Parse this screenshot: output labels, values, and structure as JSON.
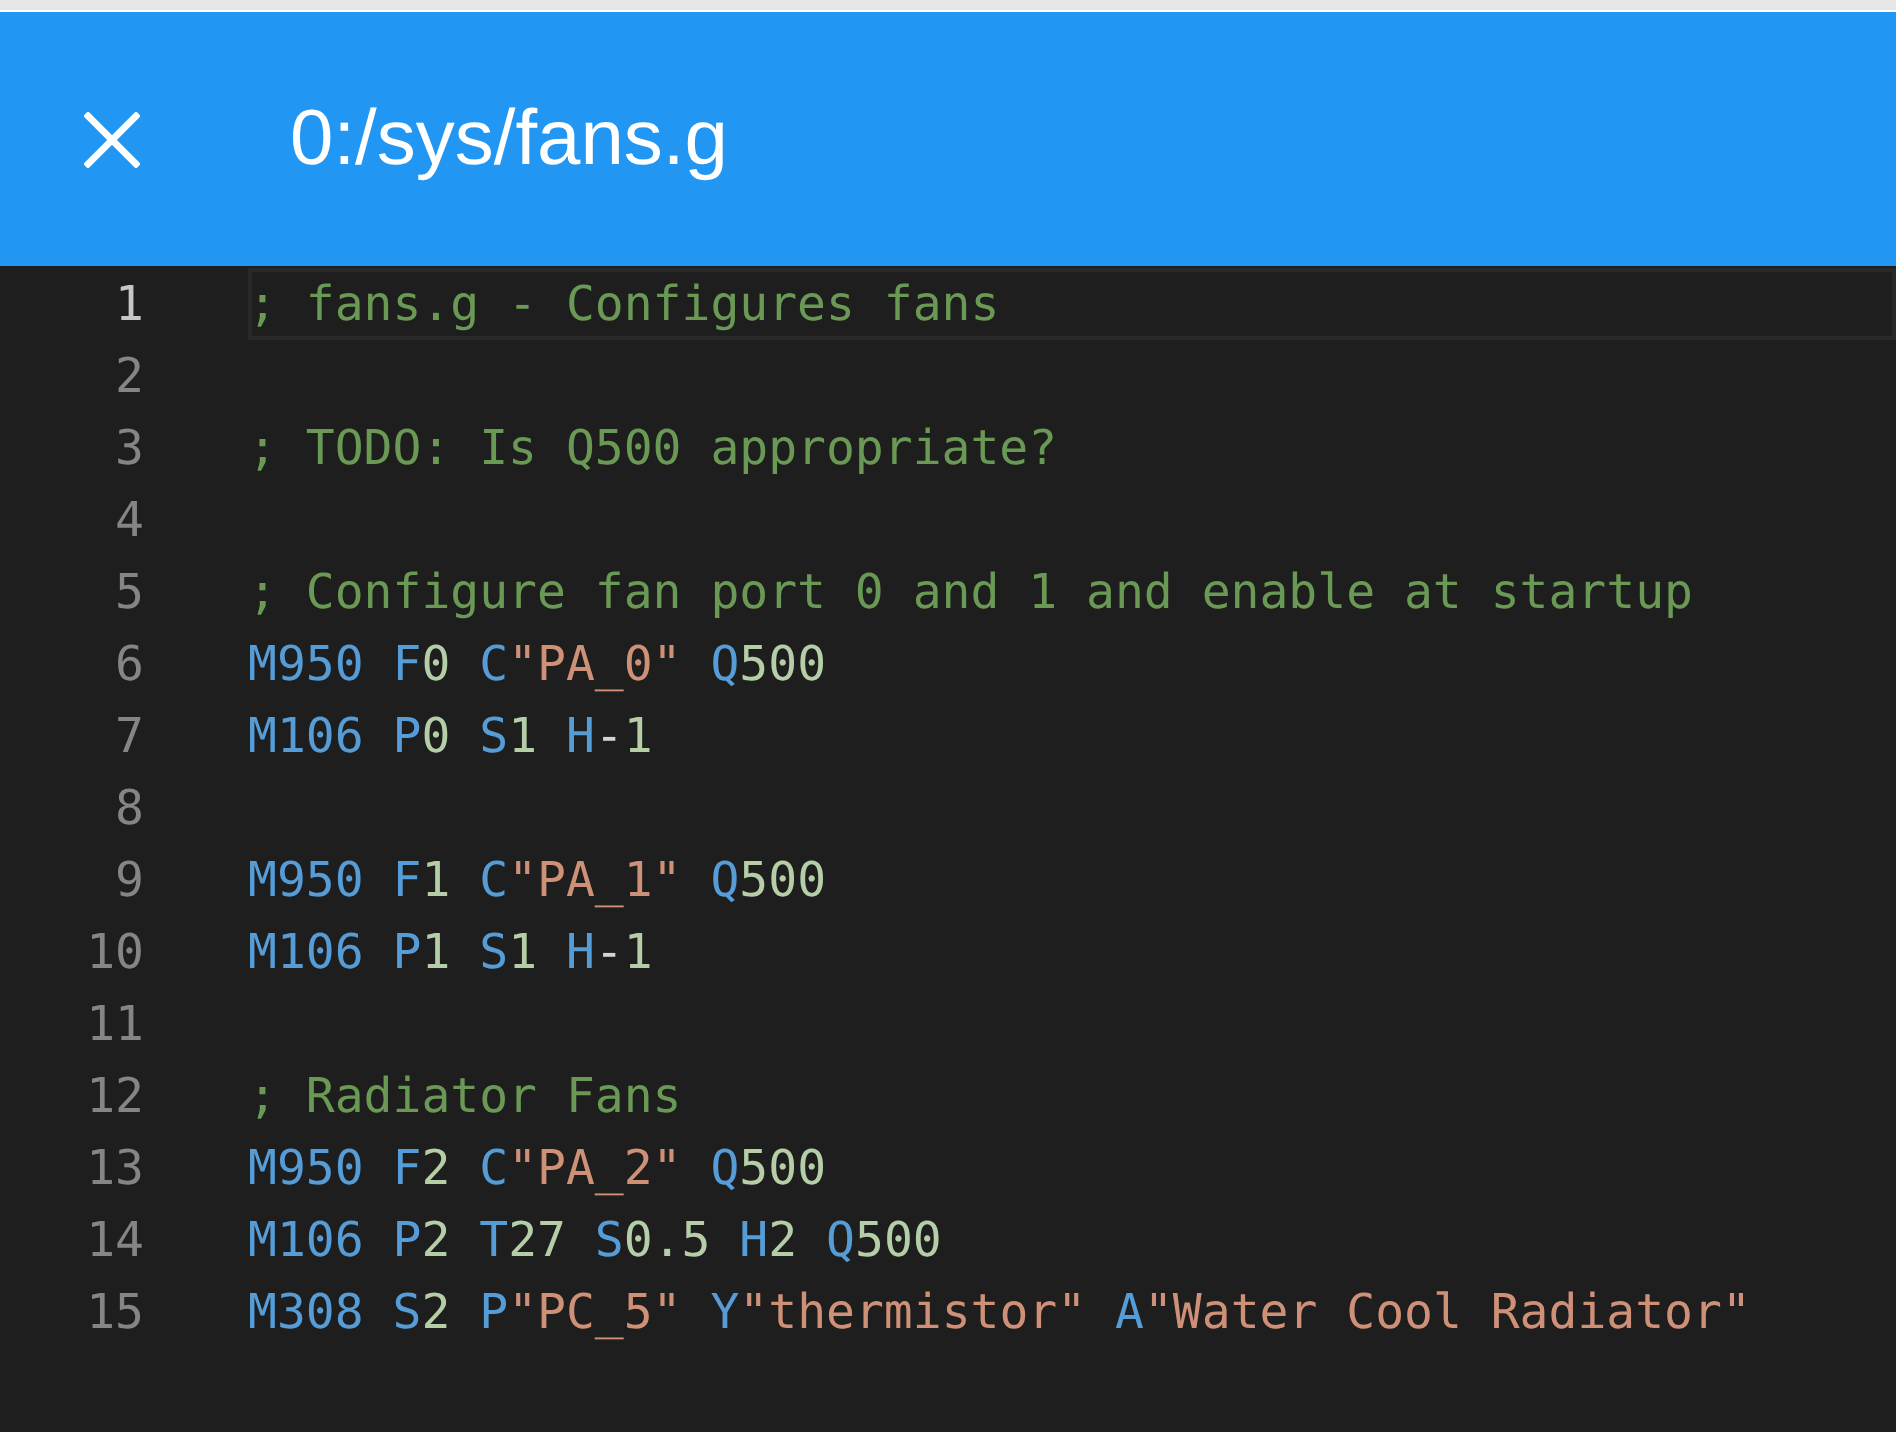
{
  "window": {
    "title": "0:/sys/fans.g"
  },
  "editor": {
    "lines": [
      {
        "number": "1",
        "current": true,
        "tokens": [
          {
            "kind": "comment",
            "text": "; fans.g - Configures fans"
          }
        ]
      },
      {
        "number": "2",
        "current": false
      },
      {
        "number": "3",
        "current": false,
        "tokens": [
          {
            "kind": "comment",
            "text": "; TODO: Is Q500 appropriate?"
          }
        ]
      },
      {
        "number": "4",
        "current": false
      },
      {
        "number": "5",
        "current": false,
        "tokens": [
          {
            "kind": "comment",
            "text": "; Configure fan port 0 and 1 and enable at startup"
          }
        ]
      },
      {
        "number": "6",
        "current": false,
        "tokens": [
          {
            "kind": "keyword",
            "text": "M950"
          },
          {
            "kind": "keyword",
            "text": " F"
          },
          {
            "kind": "number",
            "text": "0"
          },
          {
            "kind": "keyword",
            "text": " C"
          },
          {
            "kind": "string",
            "text": "\"PA_0\""
          },
          {
            "kind": "keyword",
            "text": " Q"
          },
          {
            "kind": "number",
            "text": "500"
          }
        ]
      },
      {
        "number": "7",
        "current": false,
        "tokens": [
          {
            "kind": "keyword",
            "text": "M106"
          },
          {
            "kind": "keyword",
            "text": " P"
          },
          {
            "kind": "number",
            "text": "0"
          },
          {
            "kind": "keyword",
            "text": " S"
          },
          {
            "kind": "number",
            "text": "1"
          },
          {
            "kind": "keyword",
            "text": " H"
          },
          {
            "kind": "operator",
            "text": "-"
          },
          {
            "kind": "number",
            "text": "1"
          }
        ]
      },
      {
        "number": "8",
        "current": false
      },
      {
        "number": "9",
        "current": false,
        "tokens": [
          {
            "kind": "keyword",
            "text": "M950"
          },
          {
            "kind": "keyword",
            "text": " F"
          },
          {
            "kind": "number",
            "text": "1"
          },
          {
            "kind": "keyword",
            "text": " C"
          },
          {
            "kind": "string",
            "text": "\"PA_1\""
          },
          {
            "kind": "keyword",
            "text": " Q"
          },
          {
            "kind": "number",
            "text": "500"
          }
        ]
      },
      {
        "number": "10",
        "current": false,
        "tokens": [
          {
            "kind": "keyword",
            "text": "M106"
          },
          {
            "kind": "keyword",
            "text": " P"
          },
          {
            "kind": "number",
            "text": "1"
          },
          {
            "kind": "keyword",
            "text": " S"
          },
          {
            "kind": "number",
            "text": "1"
          },
          {
            "kind": "keyword",
            "text": " H"
          },
          {
            "kind": "operator",
            "text": "-"
          },
          {
            "kind": "number",
            "text": "1"
          }
        ]
      },
      {
        "number": "11",
        "current": false
      },
      {
        "number": "12",
        "current": false,
        "tokens": [
          {
            "kind": "comment",
            "text": "; Radiator Fans"
          }
        ]
      },
      {
        "number": "13",
        "current": false,
        "tokens": [
          {
            "kind": "keyword",
            "text": "M950"
          },
          {
            "kind": "keyword",
            "text": " F"
          },
          {
            "kind": "number",
            "text": "2"
          },
          {
            "kind": "keyword",
            "text": " C"
          },
          {
            "kind": "string",
            "text": "\"PA_2\""
          },
          {
            "kind": "keyword",
            "text": " Q"
          },
          {
            "kind": "number",
            "text": "500"
          }
        ]
      },
      {
        "number": "14",
        "current": false,
        "tokens": [
          {
            "kind": "keyword",
            "text": "M106"
          },
          {
            "kind": "keyword",
            "text": " P"
          },
          {
            "kind": "number",
            "text": "2"
          },
          {
            "kind": "keyword",
            "text": " T"
          },
          {
            "kind": "number",
            "text": "27"
          },
          {
            "kind": "keyword",
            "text": " S"
          },
          {
            "kind": "number",
            "text": "0.5"
          },
          {
            "kind": "keyword",
            "text": " H"
          },
          {
            "kind": "number",
            "text": "2"
          },
          {
            "kind": "keyword",
            "text": " Q"
          },
          {
            "kind": "number",
            "text": "500"
          }
        ]
      },
      {
        "number": "15",
        "current": false,
        "tokens": [
          {
            "kind": "keyword",
            "text": "M308"
          },
          {
            "kind": "keyword",
            "text": " S"
          },
          {
            "kind": "number",
            "text": "2"
          },
          {
            "kind": "keyword",
            "text": " P"
          },
          {
            "kind": "string",
            "text": "\"PC_5\""
          },
          {
            "kind": "keyword",
            "text": " Y"
          },
          {
            "kind": "string",
            "text": "\"thermistor\""
          },
          {
            "kind": "keyword",
            "text": " A"
          },
          {
            "kind": "string",
            "text": "\"Water Cool Radiator\""
          }
        ]
      }
    ]
  }
}
